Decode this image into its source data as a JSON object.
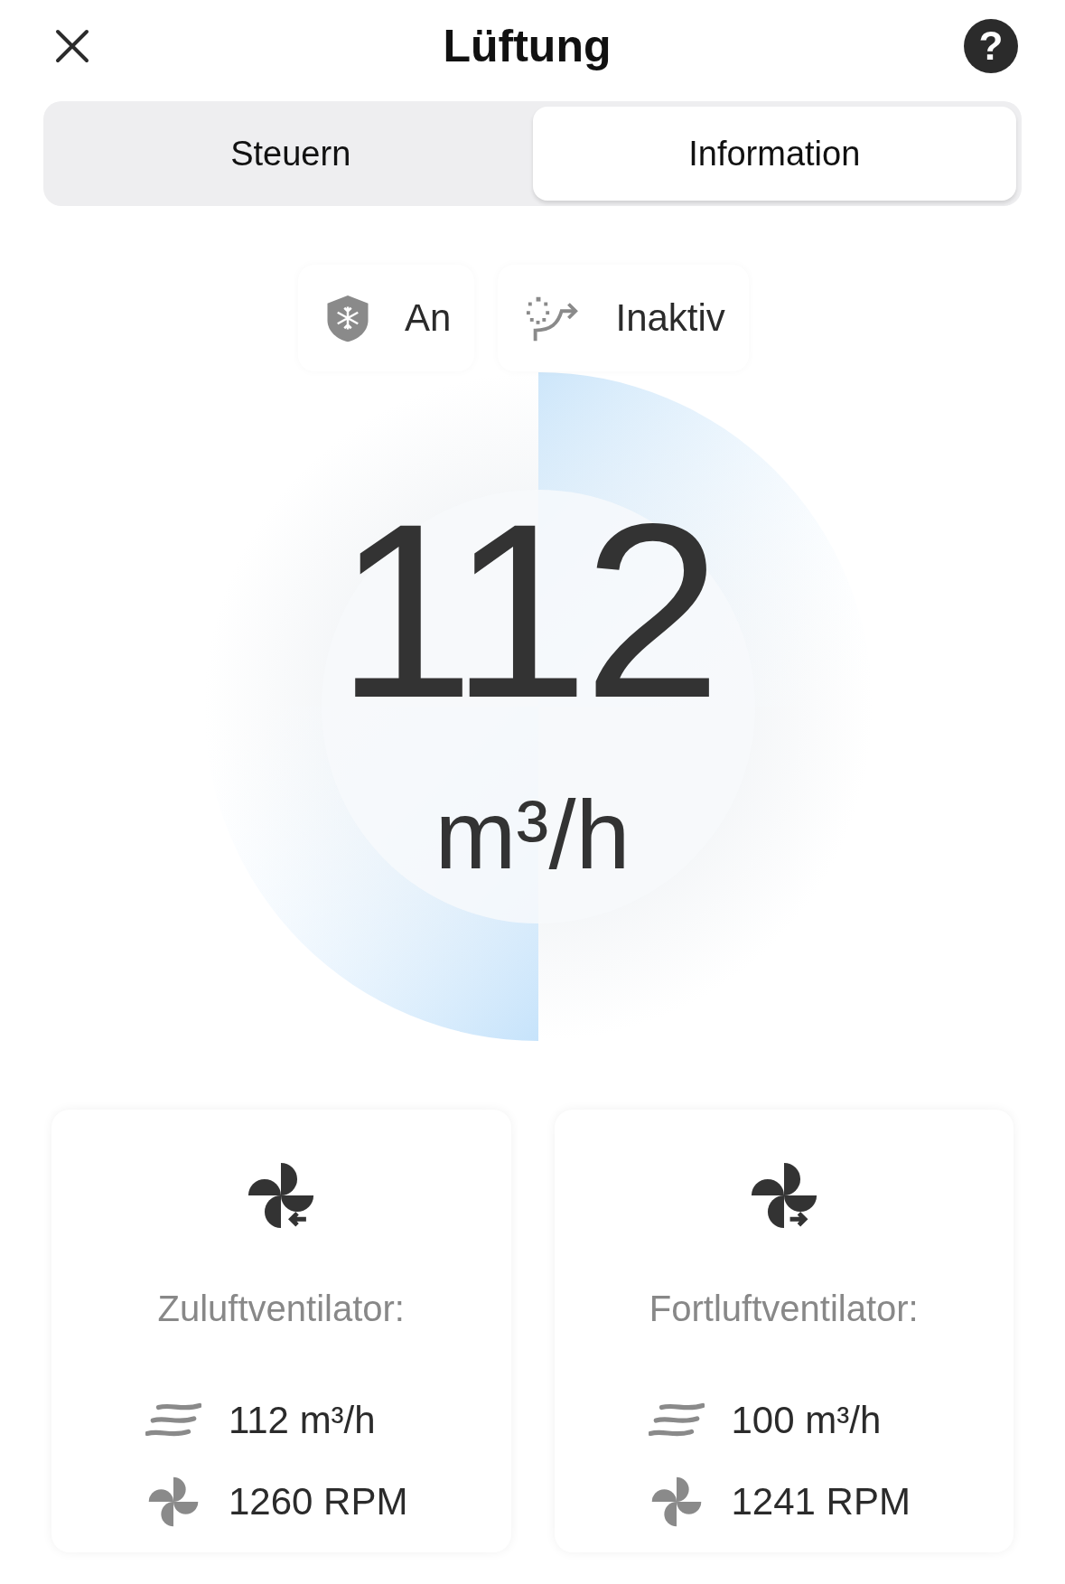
{
  "header": {
    "title": "Lüftung",
    "help": "?"
  },
  "tabs": [
    {
      "label": "Steuern",
      "selected": false
    },
    {
      "label": "Information",
      "selected": true
    }
  ],
  "status_badges": [
    {
      "kind": "frost_protection",
      "label": "An"
    },
    {
      "kind": "bypass",
      "label": "Inaktiv"
    }
  ],
  "airflow": {
    "value": "112",
    "unit": "m³/h"
  },
  "fans": [
    {
      "kind": "supply",
      "title": "Zuluftventilator:",
      "flow": "112 m³/h",
      "speed": "1260 RPM"
    },
    {
      "kind": "exhaust",
      "title": "Fortluftventilator:",
      "flow": "100 m³/h",
      "speed": "1241 RPM"
    }
  ]
}
